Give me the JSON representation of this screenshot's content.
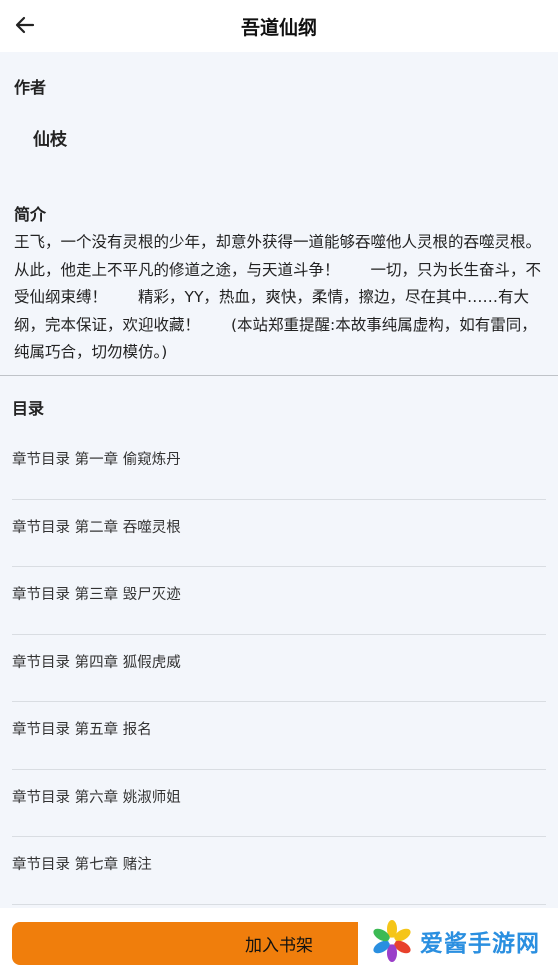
{
  "header": {
    "title": "吾道仙纲",
    "back_icon": "arrow-left-icon"
  },
  "info": {
    "author_label": "作者",
    "author_name": "仙枝",
    "intro_label": "简介",
    "intro_text": "王飞，一个没有灵根的少年，却意外获得一道能够吞噬他人灵根的吞噬灵根。从此，他走上不平凡的修道之途，与天道斗争！　　一切，只为长生奋斗，不受仙纲束缚！　　精彩，YY，热血，爽快，柔情，擦边，尽在其中……有大纲，完本保证，欢迎收藏！　　(本站郑重提醒:本故事纯属虚构，如有雷同，纯属巧合，切勿模仿。)"
  },
  "toc": {
    "label": "目录",
    "chapters": [
      "章节目录 第一章 偷窥炼丹",
      "章节目录 第二章 吞噬灵根",
      "章节目录 第三章 毁尸灭迹",
      "章节目录 第四章 狐假虎威",
      "章节目录 第五章 报名",
      "章节目录 第六章 姚淑师姐",
      "章节目录 第七章 赌注"
    ]
  },
  "footer": {
    "add_button": "加入书架"
  },
  "watermark": {
    "text": "爱酱手游网",
    "logo_icon": "pinwheel-logo-icon"
  },
  "colors": {
    "accent": "#f07e0c",
    "panel_bg": "#f3f6fb",
    "watermark_blue": "#2a8fe0"
  }
}
